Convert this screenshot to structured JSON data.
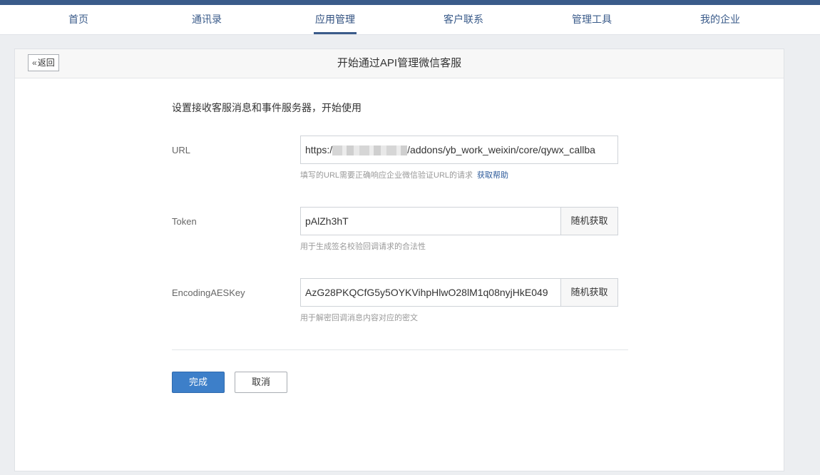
{
  "nav": {
    "items": [
      {
        "label": "首页"
      },
      {
        "label": "通讯录"
      },
      {
        "label": "应用管理",
        "active": true
      },
      {
        "label": "客户联系"
      },
      {
        "label": "管理工具"
      },
      {
        "label": "我的企业"
      }
    ]
  },
  "panel": {
    "back_label": "返回",
    "back_icon": "chevron-double-left-icon",
    "title": "开始通过API管理微信客服"
  },
  "form": {
    "intro": "设置接收客服消息和事件服务器，开始使用",
    "url": {
      "label": "URL",
      "value_prefix": "https:/",
      "value_suffix": "/addons/yb_work_weixin/core/qywx_callba",
      "hint": "填写的URL需要正确响应企业微信验证URL的请求",
      "help_link": "获取帮助"
    },
    "token": {
      "label": "Token",
      "value": "pAlZh3hT",
      "random_button": "随机获取",
      "hint": "用于生成签名校验回调请求的合法性"
    },
    "aes": {
      "label": "EncodingAESKey",
      "value": "AzG28PKQCfG5y5OYKVihpHlwO28lM1q08nyjHkE049",
      "random_button": "随机获取",
      "hint": "用于解密回调消息内容对应的密文"
    },
    "submit_label": "完成",
    "cancel_label": "取消"
  },
  "colors": {
    "brand": "#3a5b8a",
    "primary_button": "#3d7fc9",
    "link": "#2c5a9a"
  }
}
